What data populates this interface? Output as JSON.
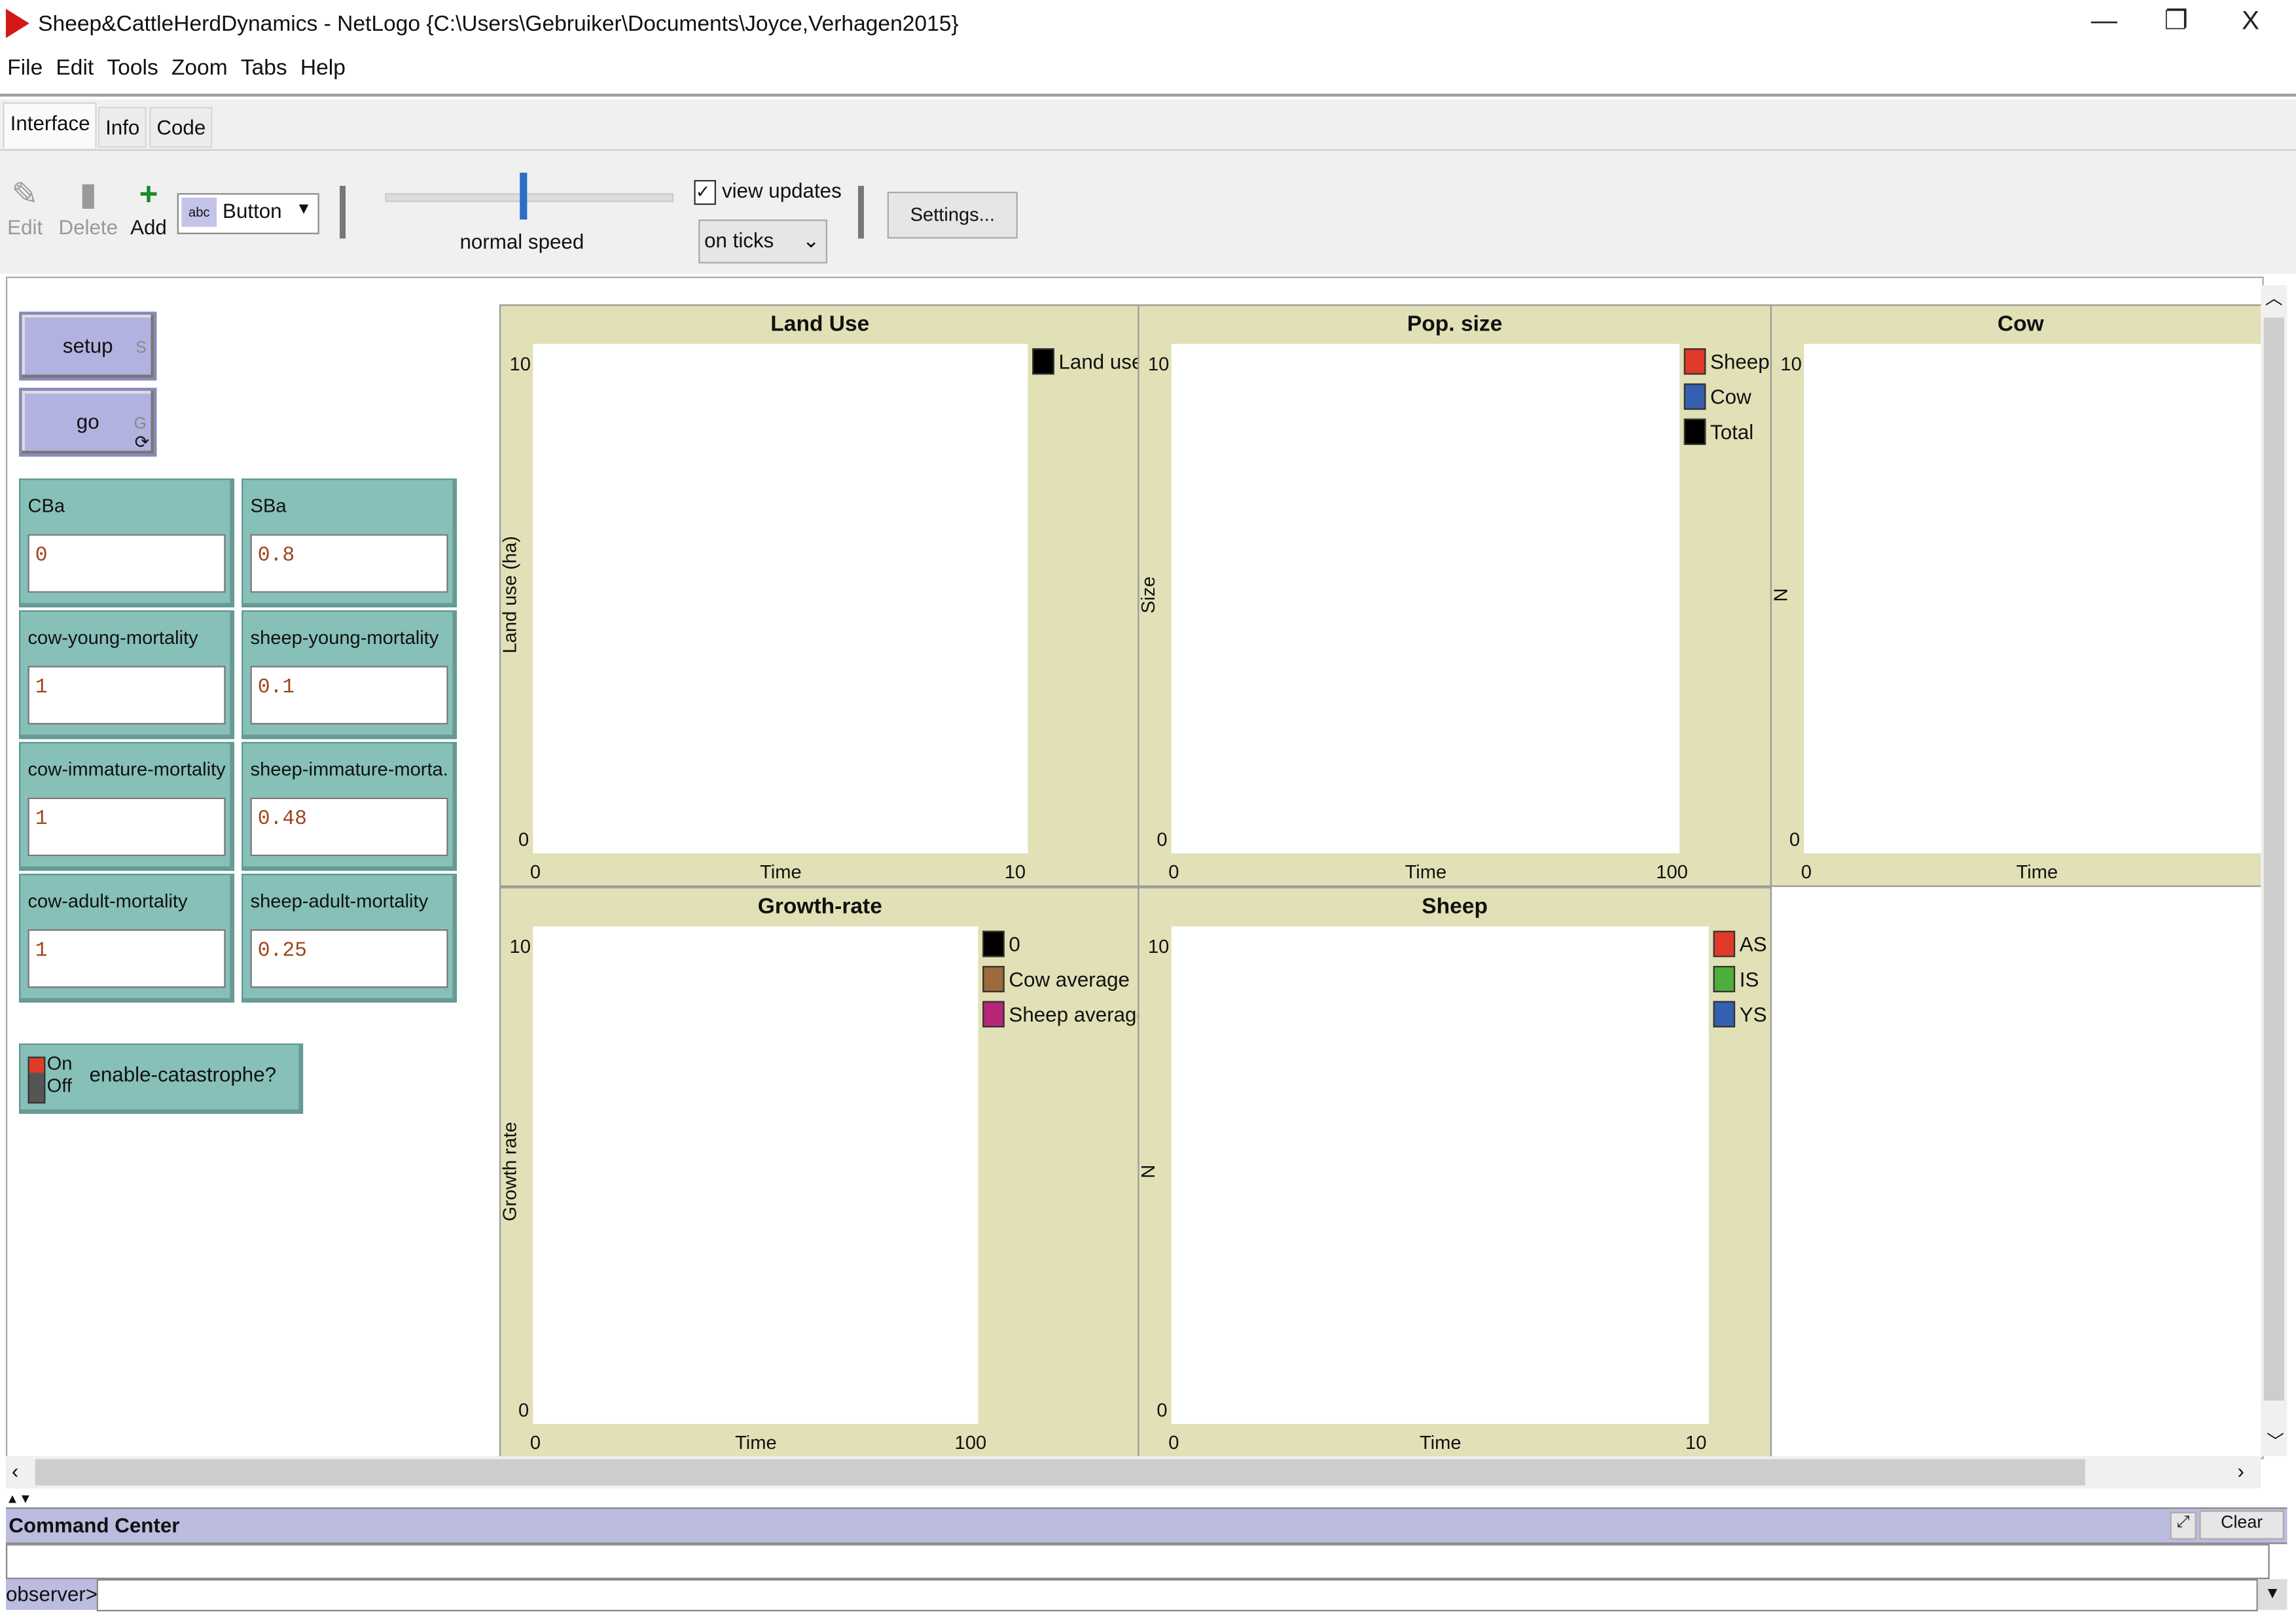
{
  "window": {
    "title": "Sheep&CattleHerdDynamics - NetLogo {C:\\Users\\Gebruiker\\Documents\\Joyce,Verhagen2015}",
    "minimize": "—",
    "maximize": "❐",
    "close": "X"
  },
  "menu": [
    "File",
    "Edit",
    "Tools",
    "Zoom",
    "Tabs",
    "Help"
  ],
  "tabs": [
    {
      "label": "Interface",
      "active": true
    },
    {
      "label": "Info"
    },
    {
      "label": "Code"
    }
  ],
  "toolbar": {
    "edit": "Edit",
    "delete": "Delete",
    "add": "Add",
    "widget_type": "Button",
    "speed_label": "normal speed",
    "speed_fraction": 0.5,
    "view_updates": "view updates",
    "view_updates_checked": true,
    "update_mode": "on ticks",
    "settings": "Settings..."
  },
  "buttons": [
    {
      "label": "setup",
      "key": "S"
    },
    {
      "label": "go",
      "key": "G",
      "forever": true
    }
  ],
  "inputs": [
    {
      "label": "CBa",
      "value": "0"
    },
    {
      "label": "SBa",
      "value": "0.8"
    },
    {
      "label": "cow-young-mortality",
      "value": "1"
    },
    {
      "label": "sheep-young-mortality",
      "value": "0.1"
    },
    {
      "label": "cow-immature-mortality",
      "value": "1"
    },
    {
      "label": "sheep-immature-morta...",
      "value": "0.48"
    },
    {
      "label": "cow-adult-mortality",
      "value": "1"
    },
    {
      "label": "sheep-adult-mortality",
      "value": "0.25"
    }
  ],
  "switch": {
    "label": "enable-catastrophe?",
    "on": "On",
    "off": "Off",
    "state": "off"
  },
  "plots": [
    {
      "title": "Land Use",
      "ylabel": "Land use (ha)",
      "xlabel": "Time",
      "ymin": "0",
      "ymax": "10",
      "xmin": "0",
      "xmax": "10",
      "legend": [
        {
          "name": "Land use",
          "color": "#000000"
        }
      ]
    },
    {
      "title": "Pop. size",
      "ylabel": "Size",
      "xlabel": "Time",
      "ymin": "0",
      "ymax": "10",
      "xmin": "0",
      "xmax": "100",
      "legend": [
        {
          "name": "Sheep",
          "color": "#e03a2a"
        },
        {
          "name": "Cow",
          "color": "#3560b0"
        },
        {
          "name": "Total",
          "color": "#000000"
        }
      ]
    },
    {
      "title": "Cow",
      "ylabel": "N",
      "xlabel": "Time",
      "ymin": "0",
      "ymax": "10",
      "xmin": "0",
      "xmax": "",
      "legend": []
    },
    {
      "title": "Growth-rate",
      "ylabel": "Growth rate",
      "xlabel": "Time",
      "ymin": "0",
      "ymax": "10",
      "xmin": "0",
      "xmax": "100",
      "legend": [
        {
          "name": "0",
          "color": "#000000"
        },
        {
          "name": "Cow average",
          "color": "#9c6a3c"
        },
        {
          "name": "Sheep average",
          "color": "#b8267a"
        }
      ]
    },
    {
      "title": "Sheep",
      "ylabel": "N",
      "xlabel": "Time",
      "ymin": "0",
      "ymax": "10",
      "xmin": "0",
      "xmax": "10",
      "legend": [
        {
          "name": "AS",
          "color": "#e03a2a"
        },
        {
          "name": "IS",
          "color": "#4cae3c"
        },
        {
          "name": "YS",
          "color": "#3560b0"
        }
      ]
    }
  ],
  "command_center": {
    "title": "Command Center",
    "clear": "Clear",
    "prompt": "observer>",
    "input": ""
  }
}
